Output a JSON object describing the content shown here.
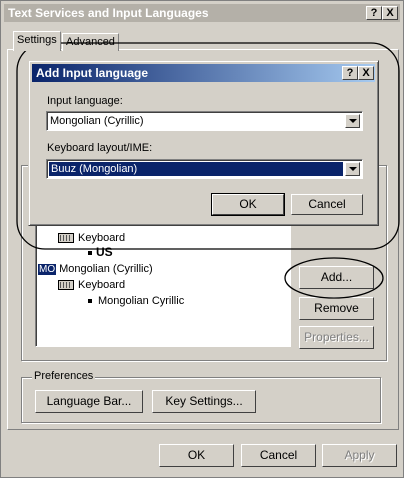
{
  "window": {
    "title": "Text Services and Input Languages",
    "help_btn": "?",
    "close_btn": "X",
    "tabs": [
      {
        "label": "Settings"
      },
      {
        "label": "Advanced"
      }
    ],
    "list": {
      "keyboard_label": "Keyboard",
      "us_label": "US",
      "lang_badge": "MO",
      "mongolian_label": "Mongolian (Cyrillic)",
      "keyboard_label2": "Keyboard",
      "mongolian_cyrillic": "Mongolian Cyrillic"
    },
    "buttons": {
      "add": "Add...",
      "remove": "Remove",
      "properties": "Properties..."
    },
    "preferences": {
      "legend": "Preferences",
      "language_bar": "Language Bar...",
      "key_settings": "Key Settings..."
    },
    "footer": {
      "ok": "OK",
      "cancel": "Cancel",
      "apply": "Apply"
    }
  },
  "dialog": {
    "title": "Add Input language",
    "help_btn": "?",
    "close_btn": "X",
    "input_language_label": "Input language:",
    "input_language_value": "Mongolian (Cyrillic)",
    "keyboard_layout_label": "Keyboard layout/IME:",
    "keyboard_layout_value": "Buuz (Mongolian)",
    "ok": "OK",
    "cancel": "Cancel"
  },
  "colors": {
    "face": "#d4d0c8",
    "selection": "#0a246a",
    "active_title": "#0a246a",
    "inactive_title": "#b4b0a8",
    "annotation": "#000000"
  }
}
